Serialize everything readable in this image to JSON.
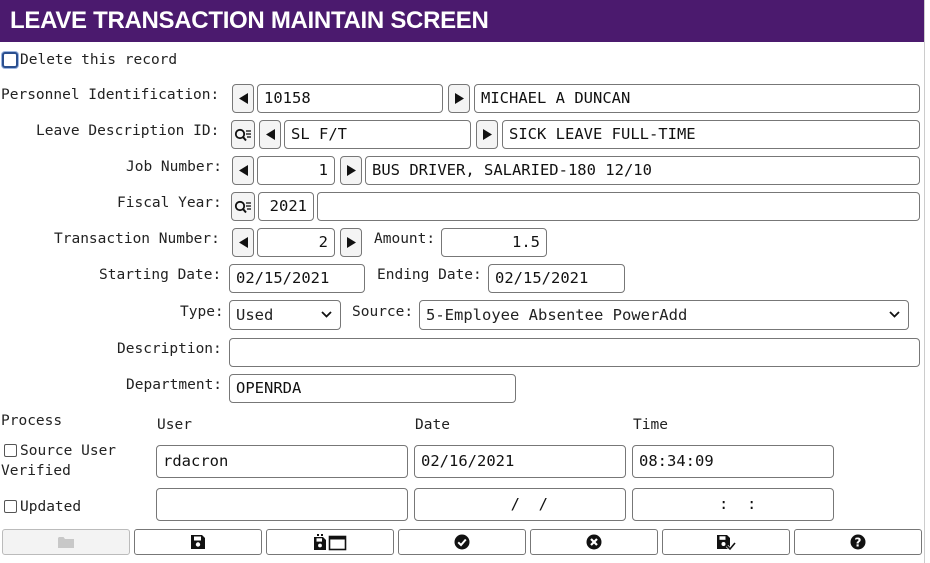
{
  "window": {
    "title": "LEAVE TRANSACTION MAINTAIN SCREEN"
  },
  "delete_record": {
    "label": "Delete this record",
    "checked": false
  },
  "personnel": {
    "label": "Personnel Identification:",
    "id": "10158",
    "name": "MICHAEL A DUNCAN"
  },
  "leave_desc": {
    "label": "Leave Description ID:",
    "id": "SL F/T",
    "name": "SICK LEAVE FULL-TIME"
  },
  "job": {
    "label": "Job Number:",
    "number": "1",
    "name": "BUS DRIVER, SALARIED-180 12/10"
  },
  "fiscal": {
    "label": "Fiscal Year:",
    "year": "2021",
    "extra": ""
  },
  "transaction": {
    "label": "Transaction Number:",
    "number": "2",
    "amount_label": "Amount:",
    "amount": "1.5"
  },
  "dates": {
    "start_label": "Starting Date:",
    "start": "02/15/2021",
    "end_label": "Ending Date:",
    "end": "02/15/2021"
  },
  "type": {
    "label": "Type:",
    "value": "Used"
  },
  "source": {
    "label": "Source:",
    "value": "5-Employee Absentee PowerAdd"
  },
  "description": {
    "label": "Description:",
    "value": ""
  },
  "department": {
    "label": "Department:",
    "value": "OPENRDA"
  },
  "process": {
    "header": "Process",
    "col_user": "User",
    "col_date": "Date",
    "col_time": "Time",
    "rows": [
      {
        "label_line1": "Source User",
        "label_line2": "Verified",
        "checked": false,
        "user": "rdacron",
        "date": "02/16/2021",
        "time": "08:34:09"
      },
      {
        "label": "Updated",
        "checked": false,
        "user": "",
        "date": "  /  /",
        "time": " :  :"
      }
    ]
  },
  "footer": {
    "buttons": [
      {
        "icon": "folder-icon",
        "enabled": false
      },
      {
        "icon": "save-icon",
        "enabled": true
      },
      {
        "icon": "save-new-icon",
        "enabled": true
      },
      {
        "icon": "check-icon",
        "enabled": true
      },
      {
        "icon": "cancel-icon",
        "enabled": true
      },
      {
        "icon": "save-check-icon",
        "enabled": true
      },
      {
        "icon": "help-icon",
        "enabled": true
      }
    ]
  },
  "colors": {
    "titlebar": "#4b1a6e",
    "title_text": "#ffffff",
    "focus_ring": "#2a4f8f"
  }
}
